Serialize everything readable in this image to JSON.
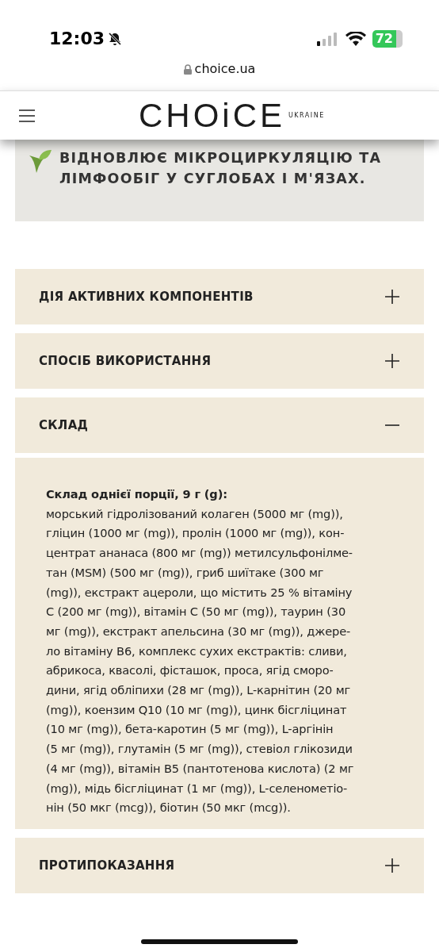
{
  "status_bar": {
    "time": "12:03",
    "battery": "72"
  },
  "address_bar": {
    "url": "choice.ua"
  },
  "header": {
    "logo": "CHOiCE",
    "logo_sub": "UKRAINE"
  },
  "banner": {
    "text": "ВІДНОВЛЮЄ МІКРОЦИРКУЛЯЦІЮ ТА ЛІМФООБІГ У СУГЛОБАХ І М'ЯЗАХ."
  },
  "accordion": [
    {
      "title": "ДІЯ АКТИВНИХ КОМПОНЕНТІВ",
      "expanded": false
    },
    {
      "title": "СПОСІБ ВИКОРИСТАННЯ",
      "expanded": false
    },
    {
      "title": "СКЛАД",
      "expanded": true,
      "body_heading": "Склад однієї порції, 9 г (g):",
      "body_lines": [
        "морський гідролізований колаген (5000 мг (mg)),",
        "гліцин (1000 мг (mg)), пролін (1000 мг (mg)), кон-",
        "центрат ананаса (800 мг (mg)) метилсульфонілме-",
        "тан (MSM) (500 мг (mg)), гриб шиїтаке (300 мг",
        "(mg)), екстракт ацероли, що містить 25 % вітаміну",
        "C (200 мг (mg)), вітамін C (50 мг (mg)), таурин (30",
        "мг (mg)), екстракт апельсина (30 мг (mg)), джере-",
        "ло вітаміну B6, комплекс сухих екстрактів: сливи,",
        "абрикоса, квасолі, фісташок, проса, ягід сморо-",
        "дини, ягід обліпихи (28 мг (mg)), L-карнітин (20 мг",
        "(mg)), коензим Q10 (10 мг (mg)), цинк бісгліцинат",
        "(10 мг (mg)), бета-каротин (5 мг (mg)), L-аргінін",
        "(5 мг (mg)), глутамін (5 мг (mg)), стевіол глікозиди",
        "(4 мг (mg)), вітамін B5 (пантотенова кислота) (2 мг",
        "(mg)), мідь бісгліцинат (1 мг (mg)), L-селенометіо-",
        "нін (50 мкг (mcg)), біотин (50 мкг (mcg))."
      ]
    },
    {
      "title": "ПРОТИПОКАЗАННЯ",
      "expanded": false
    }
  ]
}
